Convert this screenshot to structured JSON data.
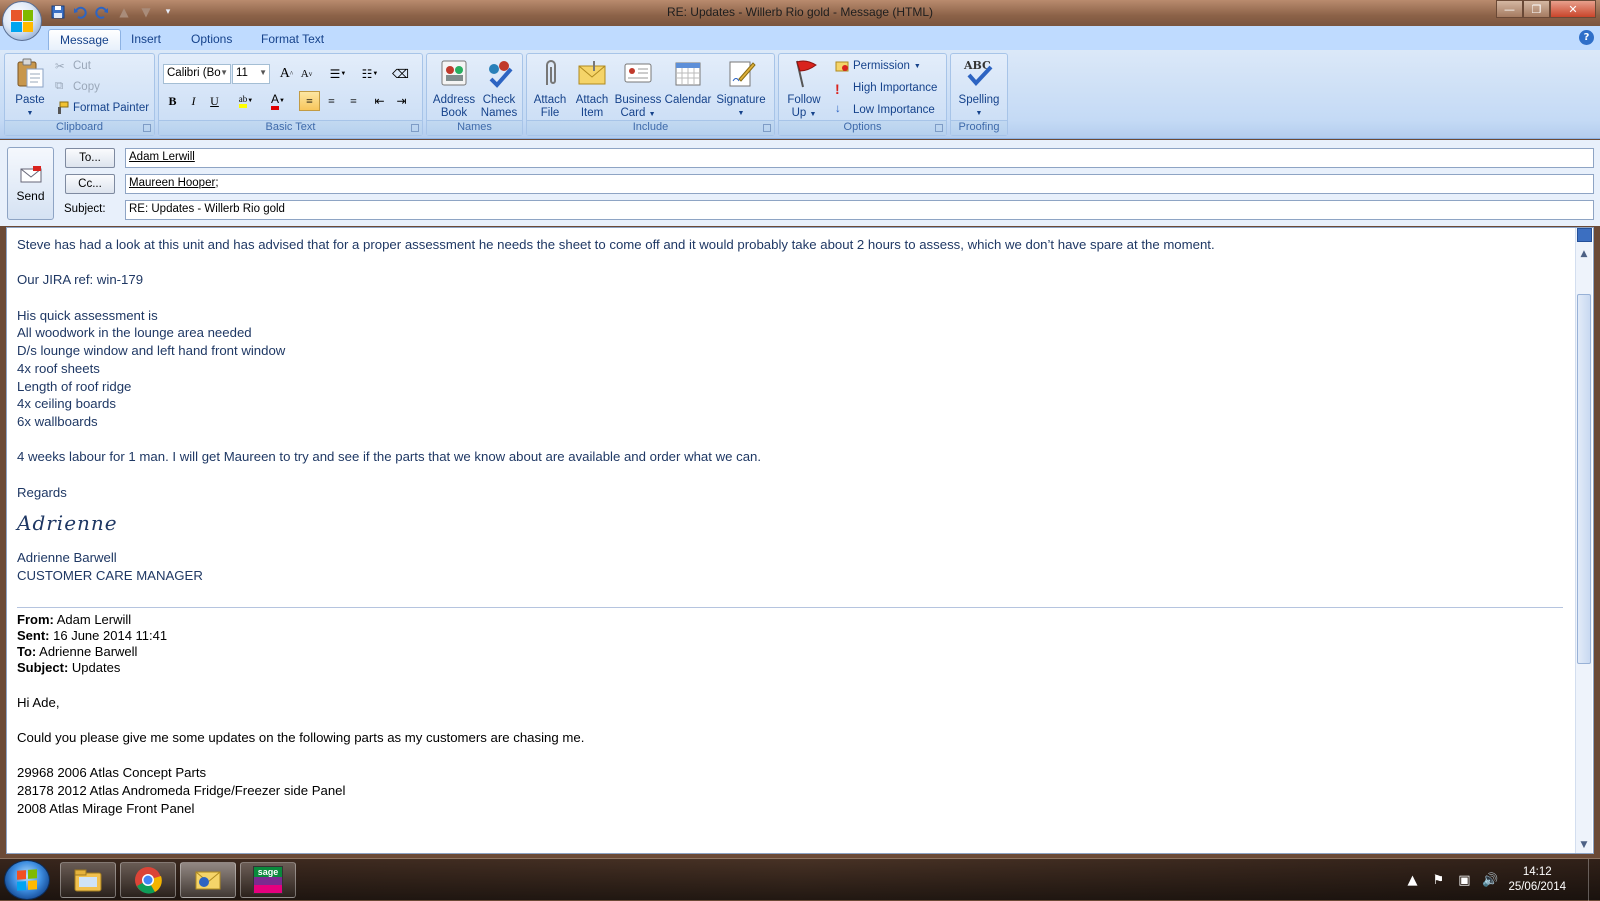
{
  "window": {
    "title": "RE: Updates - Willerb Rio gold - Message (HTML)",
    "controls": {
      "minimize": "—",
      "maximize": "❐",
      "close": "✕"
    }
  },
  "tabs": [
    {
      "label": "Message",
      "active": true
    },
    {
      "label": "Insert"
    },
    {
      "label": "Options"
    },
    {
      "label": "Format Text"
    }
  ],
  "ribbon": {
    "clipboard": {
      "label": "Clipboard",
      "paste": "Paste",
      "cut": "Cut",
      "copy": "Copy",
      "format_painter": "Format Painter"
    },
    "basic_text": {
      "label": "Basic Text",
      "font": "Calibri (Bo",
      "size": "11",
      "bold": "B",
      "italic": "I",
      "underline": "U",
      "grow": "A",
      "shrink": "A",
      "text_color": "A"
    },
    "names": {
      "label": "Names",
      "address_book": [
        "Address",
        "Book"
      ],
      "check_names": [
        "Check",
        "Names"
      ]
    },
    "include": {
      "label": "Include",
      "attach_file": [
        "Attach",
        "File"
      ],
      "attach_item": [
        "Attach",
        "Item"
      ],
      "business_card": [
        "Business",
        "Card"
      ],
      "calendar": "Calendar",
      "signature": "Signature"
    },
    "options": {
      "label": "Options",
      "follow_up": [
        "Follow",
        "Up"
      ],
      "permission": "Permission",
      "high_importance": "High Importance",
      "low_importance": "Low Importance"
    },
    "proofing": {
      "label": "Proofing",
      "spelling": "Spelling",
      "abc": "ABC"
    }
  },
  "header": {
    "send": "Send",
    "to_button": "To...",
    "cc_button": "Cc...",
    "subject_label": "Subject:",
    "to_value": "Adam Lerwill",
    "cc_value": "Maureen Hooper",
    "cc_suffix": ";",
    "subject_value": "RE: Updates - Willerb Rio gold"
  },
  "body": {
    "para1": "Steve has had a look at this unit and has advised that for a proper assessment he needs the sheet to come off and it would probably take about 2 hours to assess, which we don’t have spare at the moment.",
    "jira": "Our JIRA  ref: win-179",
    "assess_intro": "His quick assessment is",
    "assess_items": [
      "All woodwork in the lounge area needed",
      "D/s lounge window and left hand front window",
      "4x roof sheets",
      "Length of roof ridge",
      "4x ceiling boards",
      "6x wallboards"
    ],
    "para2": "4 weeks labour for 1 man.  I will get Maureen to try and see if the parts that we know about are available and order what we can.",
    "regards": "Regards",
    "signature_script": "Adrienne",
    "sig_name": "Adrienne Barwell",
    "sig_title": "CUSTOMER CARE MANAGER",
    "quoted": {
      "from_label": "From:",
      "from": "Adam Lerwill",
      "sent_label": "Sent:",
      "sent": "16 June 2014 11:41",
      "to_label": "To:",
      "to": "Adrienne Barwell",
      "subject_label": "Subject:",
      "subject": "Updates",
      "greeting": "Hi Ade,",
      "request": "Could you please give me some updates on the following parts as my customers are chasing me.",
      "parts": [
        "29968 2006 Atlas Concept Parts",
        "28178 2012 Atlas Andromeda Fridge/Freezer side Panel",
        "2008 Atlas Mirage Front Panel"
      ]
    }
  },
  "taskbar": {
    "apps": [
      "windows-explorer",
      "google-chrome",
      "outlook",
      "sage"
    ],
    "sage_label": "sage",
    "time": "14:12",
    "date": "25/06/2014"
  },
  "colors": {
    "ribbon": "#c4daf5",
    "accent": "#15428b",
    "body_text": "#1f3864"
  }
}
